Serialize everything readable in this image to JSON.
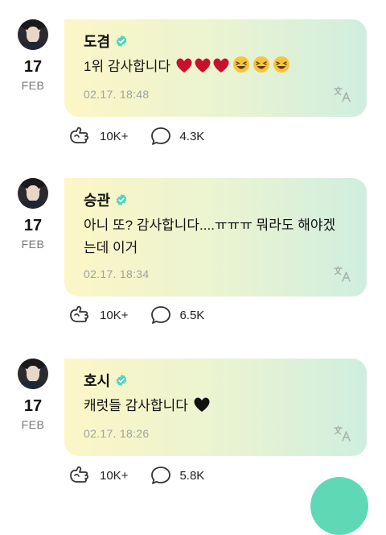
{
  "posts": [
    {
      "author": "도겸",
      "day": "17",
      "month": "FEB",
      "text": "1위 감사합니다",
      "emojis": [
        "heart-red",
        "heart-red",
        "heart-red",
        "laughing",
        "laughing",
        "laughing"
      ],
      "timestamp": "02.17. 18:48",
      "likes": "10K+",
      "comments": "4.3K"
    },
    {
      "author": "승관",
      "day": "17",
      "month": "FEB",
      "text": "아니 또? 감사합니다....ㅠㅠㅠ 뭐라도 해야겠는데 이거",
      "emojis": [],
      "timestamp": "02.17. 18:34",
      "likes": "10K+",
      "comments": "6.5K"
    },
    {
      "author": "호시",
      "day": "17",
      "month": "FEB",
      "text": "캐럿들 감사합니다",
      "emojis": [
        "heart-black"
      ],
      "timestamp": "02.17. 18:26",
      "likes": "10K+",
      "comments": "5.8K"
    }
  ],
  "colors": {
    "verified": "#4fd6c0",
    "bubble_start": "#fcf6c6",
    "bubble_end": "#cfeedf",
    "fab": "#5fd9b5"
  },
  "icons": [
    "verified-badge-icon",
    "translate-icon",
    "like-hand-icon",
    "comment-bubble-icon"
  ]
}
